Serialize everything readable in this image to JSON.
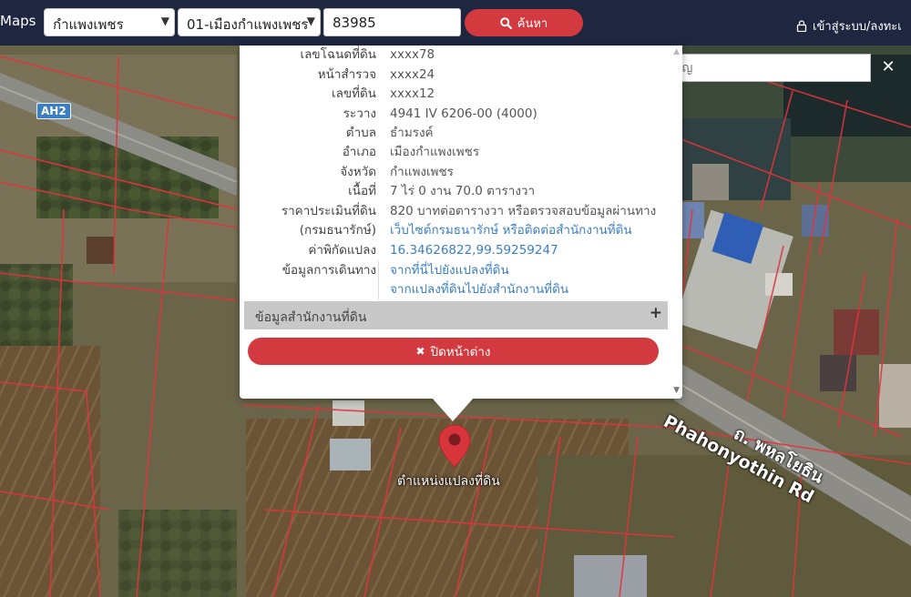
{
  "header": {
    "brand": "Maps",
    "province_select": "กำแพงเพชร",
    "district_select": "01-เมืองกำแพงเพชร",
    "parcel_input": "83985",
    "search_label": "ค้นหา",
    "login_label": "เข้าสู่ระบบ/ลงทะเ"
  },
  "landmark_search": {
    "placeholder": "ค้นหาสถานที่สำคัญ",
    "clear_icon": "close-icon"
  },
  "parcel_info": {
    "rows": [
      {
        "label": "เลขโฉนดที่ดิน",
        "value": "xxxx78"
      },
      {
        "label": "หน้าสำรวจ",
        "value": "xxxx24"
      },
      {
        "label": "เลขที่ดิน",
        "value": "xxxx12"
      },
      {
        "label": "ระวาง",
        "value": "4941 IV 6206-00 (4000)"
      },
      {
        "label": "ตำบล",
        "value": "ธำมรงค์"
      },
      {
        "label": "อำเภอ",
        "value": "เมืองกำแพงเพชร"
      },
      {
        "label": "จังหวัด",
        "value": "กำแพงเพชร"
      },
      {
        "label": "เนื้อที่",
        "value": "7 ไร่ 0 งาน 70.0 ตารางวา"
      },
      {
        "label": "ราคาประเมินที่ดิน",
        "value": "820 บาทต่อตารางวา หรือตรวจสอบข้อมูลผ่านทาง"
      },
      {
        "label": "(กรมธนารักษ์)",
        "value": "เว็บไซต์กรมธนารักษ์ หรือติดต่อสำนักงานที่ดิน"
      },
      {
        "label": "ค่าพิกัดแปลง",
        "value": "16.34626822,99.59259247"
      },
      {
        "label": "ข้อมูลการเดินทาง",
        "value": "จากที่นี่ไปยังแปลงที่ดิน"
      }
    ],
    "travel_link_2": "จากแปลงที่ดินไปยังสำนักงานที่ดิน",
    "office_section": "ข้อมูลสำนักงานที่ดิน",
    "close_button": "ปิดหน้าต่าง"
  },
  "map": {
    "marker_label": "ตำแหน่งแปลงที่ดิน",
    "road_badge": "AH2",
    "road_name_th": "ถ. พหลโยธิน",
    "road_name_en": "Phahonyothin Rd",
    "parcel_line_color": "#e0343d",
    "marker_color": "#d8353b"
  }
}
